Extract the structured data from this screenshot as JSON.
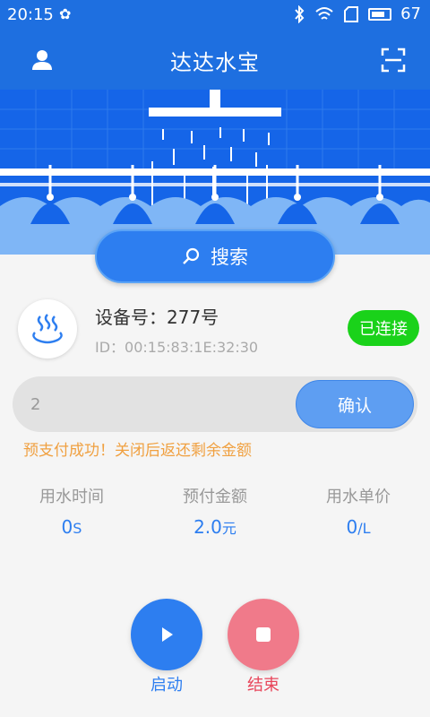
{
  "status_bar": {
    "time": "20:15",
    "battery": "67",
    "notification_icon": "flower-icon"
  },
  "app_bar": {
    "title": "达达水宝",
    "left_icon": "user-icon",
    "right_icon": "scan-icon"
  },
  "search": {
    "label": "搜索",
    "icon": "search-icon"
  },
  "device": {
    "icon": "hot-spring-icon",
    "label": "设备号：277号",
    "id": "ID：00:15:83:1E:32:30",
    "status": "已连接"
  },
  "amount": {
    "value": "2",
    "confirm_label": "确认"
  },
  "notice": "预支付成功！关闭后返还剩余金额",
  "stats": {
    "time_label": "用水时间",
    "time_value": "0",
    "time_unit": "S",
    "prepay_label": "预付金额",
    "prepay_value": "2.0",
    "prepay_unit": "元",
    "price_label": "用水单价",
    "price_value": "0",
    "price_unit": "/L"
  },
  "controls": {
    "start_label": "启动",
    "stop_label": "结束"
  },
  "colors": {
    "primary": "#1e6fe0",
    "accent_blue": "#2d7ef0",
    "connected_green": "#1ad21a",
    "notice_orange": "#f0a040",
    "stop_pink": "#f07a8a"
  }
}
